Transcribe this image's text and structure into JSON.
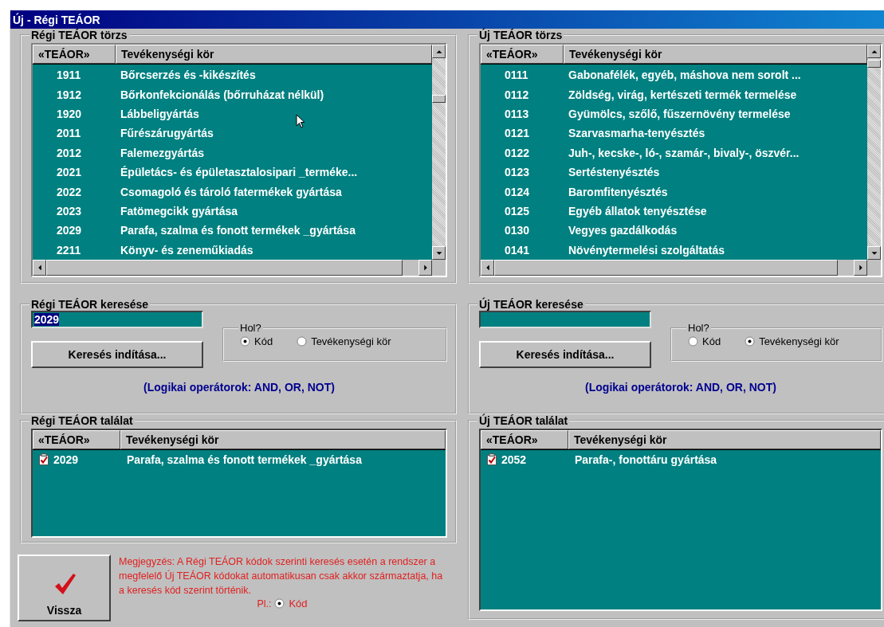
{
  "window": {
    "title": "Új - Régi TEÁOR"
  },
  "panels": [
    {
      "master": {
        "title": "Régi TEÁOR törzs",
        "columns": [
          "«TEÁOR»",
          "Tevékenységi kör"
        ],
        "rows": [
          {
            "code": "1911",
            "text": "Bőrcserzés és -kikészítés"
          },
          {
            "code": "1912",
            "text": "Bőrkonfekcionálás (bőrruházat nélkül)"
          },
          {
            "code": "1920",
            "text": "Lábbeligyártás"
          },
          {
            "code": "2011",
            "text": "Fűrészárugyártás"
          },
          {
            "code": "2012",
            "text": "Falemezgyártás"
          },
          {
            "code": "2021",
            "text": "Épületács- és épületasztalosipari _terméke..."
          },
          {
            "code": "2022",
            "text": "Csomagoló és tároló fatermékek gyártása"
          },
          {
            "code": "2023",
            "text": "Fatömegcikk gyártása"
          },
          {
            "code": "2029",
            "text": "Parafa, szalma és fonott termékek _gyártása"
          },
          {
            "code": "2211",
            "text": "Könyv- és zeneműkiadás"
          }
        ]
      },
      "search": {
        "title": "Régi TEÁOR keresése",
        "value": "2029",
        "value_highlighted": true,
        "button": "Keresés indítása...",
        "where": {
          "title": "Hol?",
          "options": [
            {
              "label": "Kód",
              "selected": true
            },
            {
              "label": "Tevékenységi kör",
              "selected": false
            }
          ]
        },
        "hint": "(Logikai operátorok: AND, OR, NOT)"
      },
      "result": {
        "title": "Régi TEÁOR találat",
        "columns": [
          "«TEÁOR»",
          "Tevékenységi kör"
        ],
        "rows": [
          {
            "code": "2029",
            "text": "Parafa, szalma és fonott termékek _gyártása",
            "checked": true
          }
        ]
      }
    },
    {
      "master": {
        "title": "Új TEÁOR törzs",
        "columns": [
          "«TEÁOR»",
          "Tevékenységi kör"
        ],
        "rows": [
          {
            "code": "0111",
            "text": "Gabonafélék, egyéb, máshova nem sorolt ..."
          },
          {
            "code": "0112",
            "text": "Zöldség, virág, kertészeti termék termelése"
          },
          {
            "code": "0113",
            "text": "Gyümölcs, szőlő, fűszernövény termelése"
          },
          {
            "code": "0121",
            "text": "Szarvasmarha-tenyésztés"
          },
          {
            "code": "0122",
            "text": "Juh-, kecske-, ló-, szamár-, bivaly-, öszvér..."
          },
          {
            "code": "0123",
            "text": "Sertéstenyésztés"
          },
          {
            "code": "0124",
            "text": "Baromfitenyésztés"
          },
          {
            "code": "0125",
            "text": "Egyéb állatok tenyésztése"
          },
          {
            "code": "0130",
            "text": "Vegyes gazdálkodás"
          },
          {
            "code": "0141",
            "text": "Növénytermelési szolgáltatás"
          }
        ]
      },
      "search": {
        "title": "Új TEÁOR keresése",
        "button": "Keresés indítása...",
        "where": {
          "title": "Hol?",
          "options": [
            {
              "label": "Kód",
              "selected": false
            },
            {
              "label": "Tevékenységi kör",
              "selected": true
            }
          ]
        },
        "hint": "(Logikai operátorok: AND, OR, NOT)"
      },
      "result": {
        "title": "Új TEÁOR találat",
        "columns": [
          "«TEÁOR»",
          "Tevékenységi kör"
        ],
        "rows": [
          {
            "code": "2052",
            "text": "Parafa-, fonottáru gyártása",
            "checked": true
          }
        ]
      }
    }
  ],
  "footer": {
    "back_button": "Vissza",
    "note": "Megjegyzés: A Régi TEÁOR kódok szerinti keresés esetén a rendszer a megfelelő Új TEÁOR kódokat automatikusan csak akkor származtatja, ha a keresés kód szerint történik.",
    "example": {
      "prefix": "Pl.:",
      "option": {
        "label": "Kód",
        "selected": true
      }
    }
  }
}
